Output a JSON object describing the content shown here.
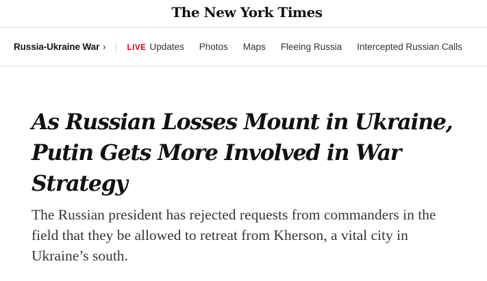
{
  "masthead": {
    "logo_text": "The New York Times"
  },
  "nav": {
    "section_label": "Russia-Ukraine War",
    "section_chevron": "›",
    "live_tag": "LIVE",
    "live_label": "Updates",
    "items": [
      {
        "label": "Photos"
      },
      {
        "label": "Maps"
      },
      {
        "label": "Fleeing Russia"
      },
      {
        "label": "Intercepted Russian Calls"
      }
    ]
  },
  "article": {
    "headline": "As Russian Losses Mount in Ukraine, Putin Gets More Involved in War Strategy",
    "summary": "The Russian president has rejected requests from commanders in the field that they be allowed to retreat from Kherson, a vital city in Ukraine’s south."
  },
  "colors": {
    "live_red": "#d0021b",
    "text_primary": "#121212",
    "text_summary": "#363636",
    "rule": "#dfdfdf"
  }
}
